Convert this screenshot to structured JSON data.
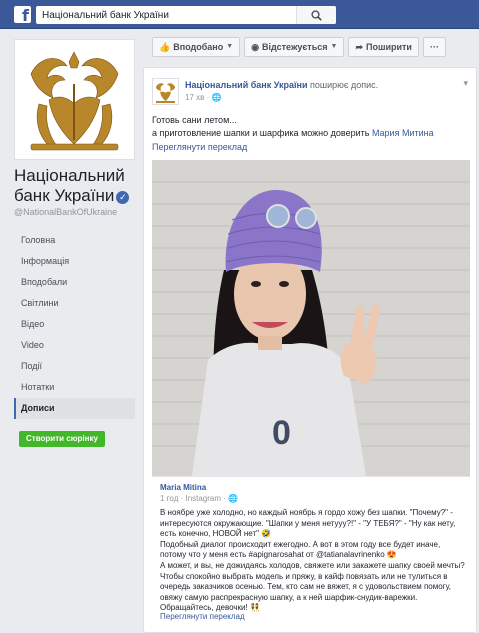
{
  "topbar": {
    "logo": "f",
    "search_value": "Національний банк України",
    "search_icon": "search-icon"
  },
  "page": {
    "name": "Національний банк України",
    "handle": "@NationalBankOfUkraine",
    "verified_icon": "verified-badge-icon",
    "colors": {
      "brand": "#3b5998",
      "link": "#365899",
      "green": "#42b72a",
      "gold": "#b8862b"
    }
  },
  "nav": {
    "items": [
      "Головна",
      "Інформація",
      "Вподобали",
      "Світлини",
      "Відео",
      "Video",
      "Події",
      "Нотатки",
      "Дописи"
    ],
    "active": "Дописи",
    "create_story": "Створити сюрінку"
  },
  "actions": {
    "like": "Вподобано",
    "follow": "Відстежується",
    "share": "Поширити",
    "more": "···"
  },
  "post": {
    "author": "Національний банк України",
    "action": " поширює допис.",
    "time": "17 хв · ",
    "globe_icon": "globe-icon",
    "text_line1": "Готовь сани летом...",
    "text_line2": "а приготовление шапки и шарфика можно доверить ",
    "text_link": "Мария Митина",
    "see_translation": "Переглянути переклад"
  },
  "shared": {
    "author": "Maria Mitina",
    "meta": "1 год · Instagram · ",
    "body": [
      "В ноябре уже холодно, но каждый ноябрь я гордо хожу без шапки. \"Почему?\" - интересуются окружающие. \"Шапки у меня нетууу?!\" - \"У ТЕБЯ?\" - \"Ну как нету, есть конечно, НОВОЙ нет\" 🤣",
      "Подобный диалог происходит ежегодно. А вот в этом году все будет иначе, потому что у меня есть #apignarosahat от @tatianalavrinenko 😍",
      "А может, и вы, не дожидаясь холодов, свяжете или закажете шапку своей мечты? Чтобы спокойно выбрать модель и пряжу, в кайф повязать или не тулиться в очередь заказчиков осенью. Тем, кто сам не вяжет, я с удовольствием помогу, овяжу самую распрекрасную шапку, а к ней шарфик-снудик-варежки. Обращайтесь, девочки! 👯"
    ],
    "see_translation": "Переглянути переклад"
  }
}
